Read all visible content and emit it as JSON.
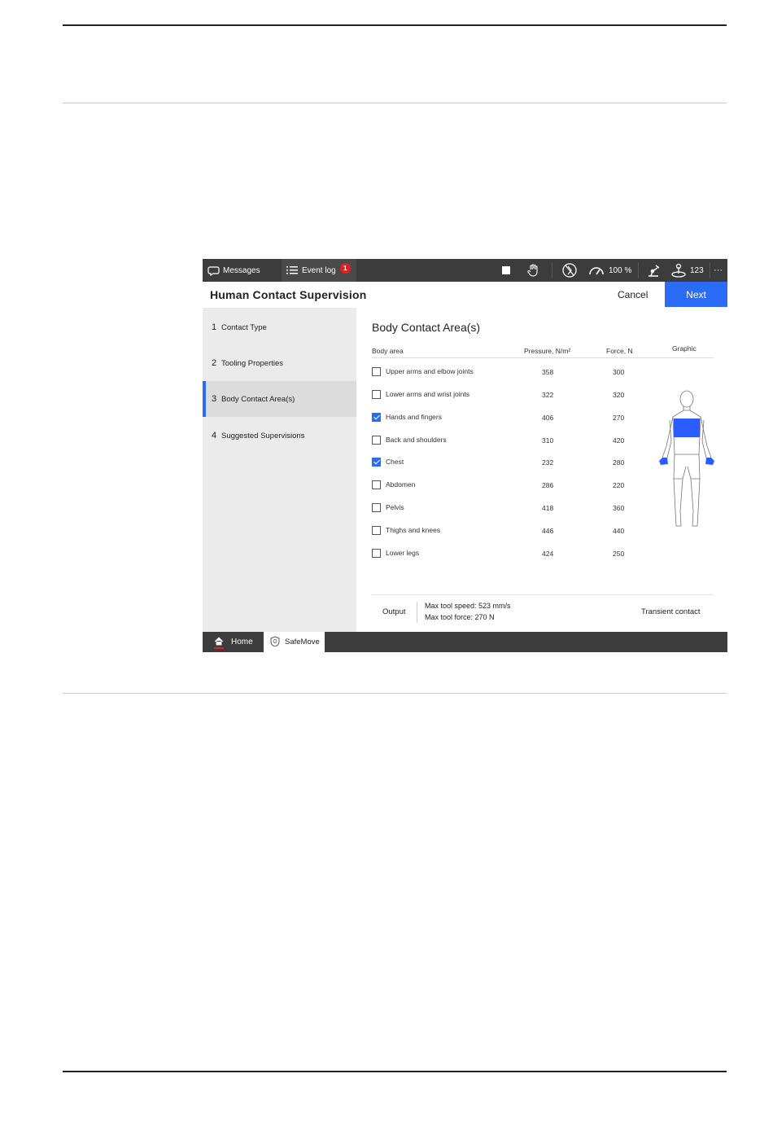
{
  "topbar": {
    "messages": "Messages",
    "event_log": "Event log",
    "event_badge": "1",
    "speed": "100 %",
    "counter": "123",
    "more": "···"
  },
  "header": {
    "title": "Human Contact Supervision",
    "cancel": "Cancel",
    "next": "Next"
  },
  "steps": [
    {
      "num": "1",
      "label": "Contact Type"
    },
    {
      "num": "2",
      "label": "Tooling Properties"
    },
    {
      "num": "3",
      "label": "Body Contact Area(s)",
      "active": true
    },
    {
      "num": "4",
      "label": "Suggested Supervisions"
    }
  ],
  "main": {
    "title": "Body Contact Area(s)",
    "columns": {
      "area": "Body area",
      "pressure": "Pressure, N/m²",
      "force": "Force, N",
      "graphic": "Graphic"
    },
    "rows": [
      {
        "label": "Upper arms and elbow joints",
        "pressure": "358",
        "force": "300",
        "checked": false
      },
      {
        "label": "Lower arms and wrist joints",
        "pressure": "322",
        "force": "320",
        "checked": false
      },
      {
        "label": "Hands and fingers",
        "pressure": "406",
        "force": "270",
        "checked": true
      },
      {
        "label": "Back and shoulders",
        "pressure": "310",
        "force": "420",
        "checked": false
      },
      {
        "label": "Chest",
        "pressure": "232",
        "force": "280",
        "checked": true
      },
      {
        "label": "Abdomen",
        "pressure": "286",
        "force": "220",
        "checked": false
      },
      {
        "label": "Pelvis",
        "pressure": "418",
        "force": "360",
        "checked": false
      },
      {
        "label": "Thighs and knees",
        "pressure": "446",
        "force": "440",
        "checked": false
      },
      {
        "label": "Lower legs",
        "pressure": "424",
        "force": "250",
        "checked": false
      }
    ],
    "output": {
      "label": "Output",
      "speed_line": "Max tool speed: 523 mm/s",
      "force_line": "Max tool force:  270  N",
      "contact_type": "Transient contact"
    }
  },
  "bottombar": {
    "home": "Home",
    "app_tab": "SafeMove"
  },
  "colors": {
    "accent": "#2a6cf6",
    "topbar": "#3c3c3c",
    "badge": "#e02020"
  }
}
